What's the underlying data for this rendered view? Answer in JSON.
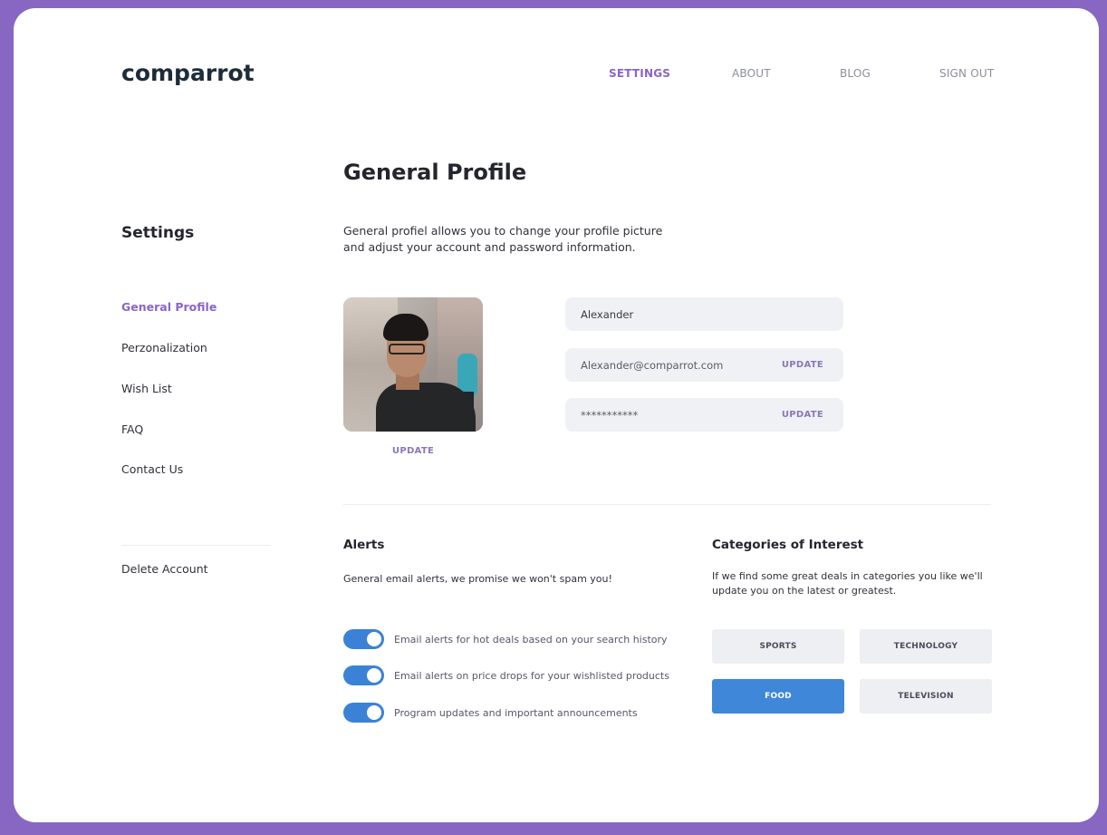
{
  "brand": {
    "logo": "comparrot",
    "accent_color": "#8a64c8",
    "background_color": "#8767c2",
    "toggle_color": "#3b82d6"
  },
  "nav": {
    "items": [
      {
        "label": "SETTINGS",
        "active": true
      },
      {
        "label": "ABOUT",
        "active": false
      },
      {
        "label": "BLOG",
        "active": false
      },
      {
        "label": "SIGN OUT",
        "active": false
      }
    ]
  },
  "sidebar": {
    "title": "Settings",
    "items": [
      {
        "label": "General Profile",
        "active": true
      },
      {
        "label": "Perzonalization",
        "active": false
      },
      {
        "label": "Wish List",
        "active": false
      },
      {
        "label": "FAQ",
        "active": false
      },
      {
        "label": "Contact Us",
        "active": false
      }
    ],
    "delete_account": "Delete Account"
  },
  "main": {
    "title": "General Profile",
    "description": "General profiel allows you to change your profile picture and adjust your account and password information.",
    "avatar_update_label": "UPDATE",
    "fields": {
      "name": {
        "value": "Alexander"
      },
      "email": {
        "value": "Alexander@comparrot.com",
        "action": "UPDATE"
      },
      "password": {
        "value": "***********",
        "action": "UPDATE"
      }
    }
  },
  "alerts": {
    "title": "Alerts",
    "description": "General email alerts, we promise we won't spam you!",
    "toggles": [
      {
        "label": "Email alerts for hot deals based on your search history",
        "on": true
      },
      {
        "label": "Email alerts on price drops for your wishlisted products",
        "on": true
      },
      {
        "label": "Program updates and important announcements",
        "on": true
      }
    ]
  },
  "categories": {
    "title": "Categories of Interest",
    "description": "If we find some great deals in categories you like we'll update you on the latest or greatest.",
    "items": [
      {
        "label": "SPORTS",
        "selected": false
      },
      {
        "label": "TECHNOLOGY",
        "selected": false
      },
      {
        "label": "FOOD",
        "selected": true
      },
      {
        "label": "TELEVISION",
        "selected": false
      }
    ]
  }
}
